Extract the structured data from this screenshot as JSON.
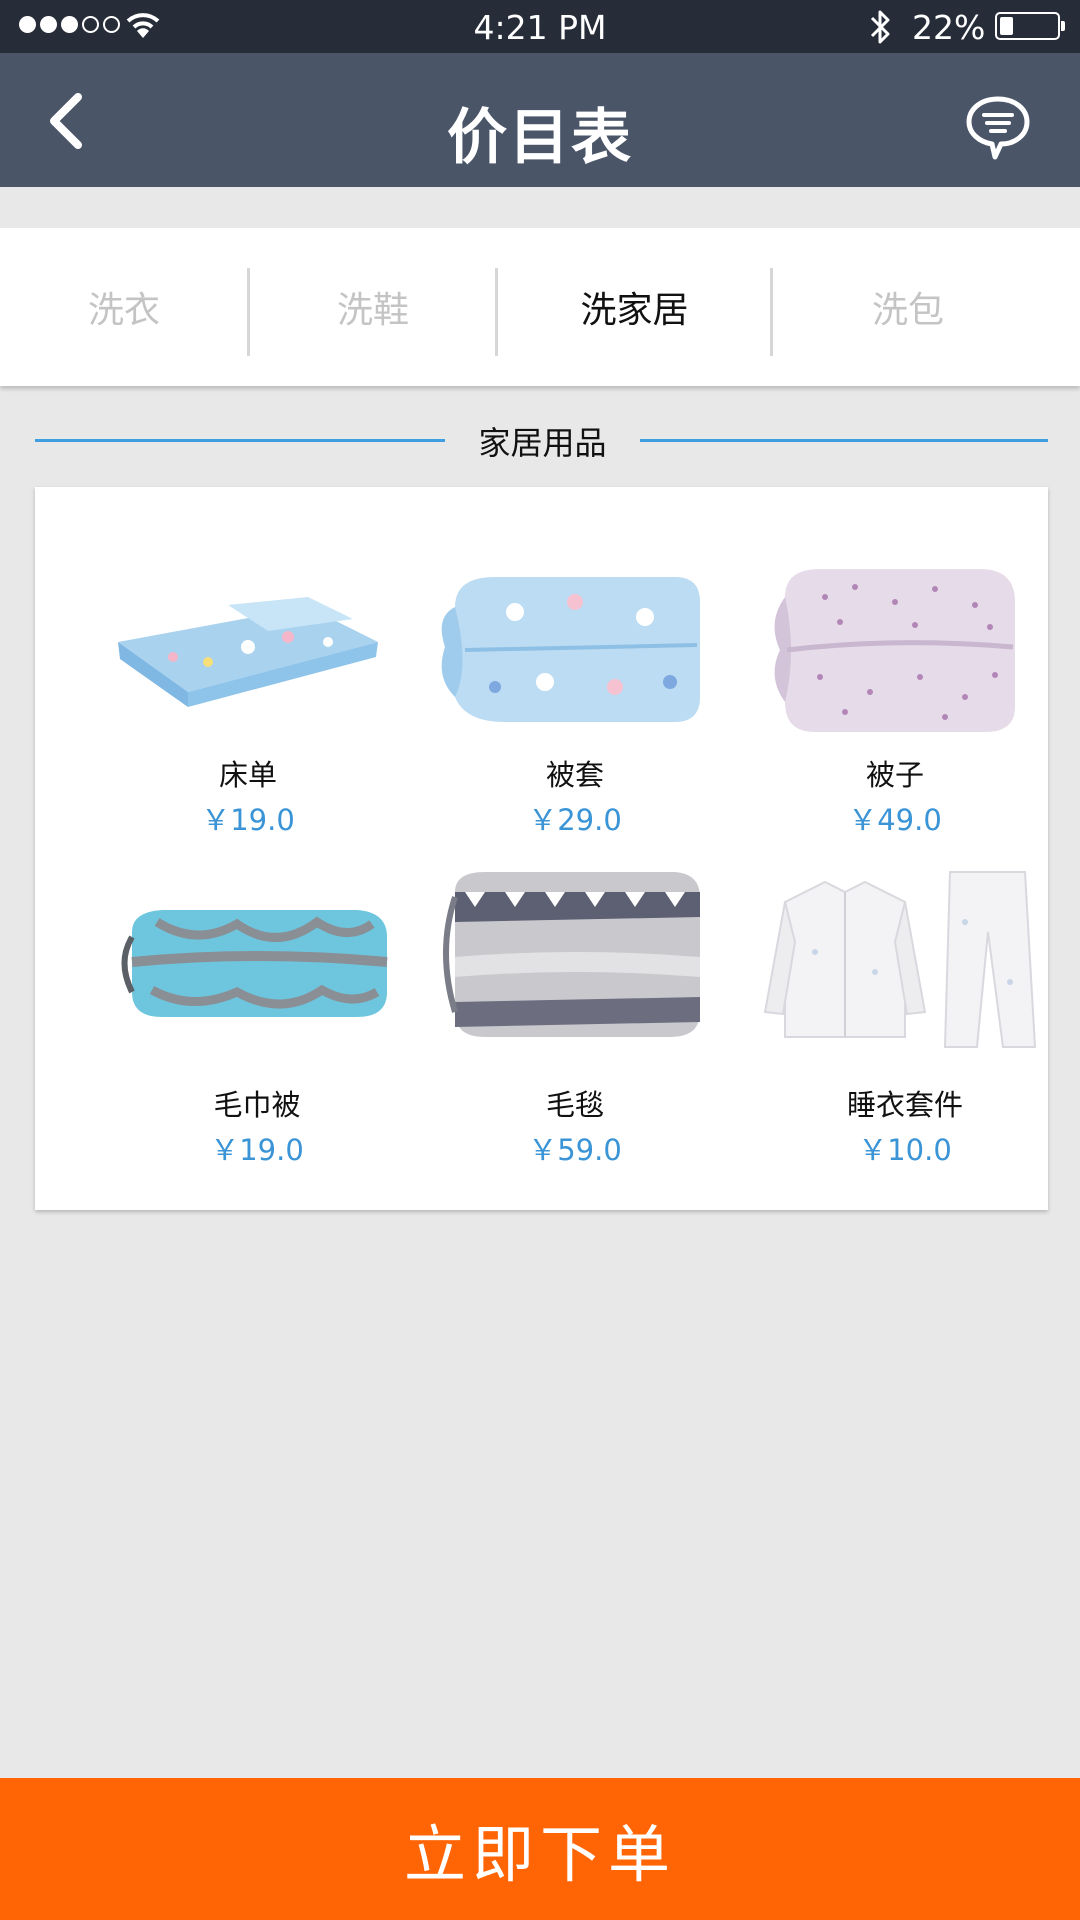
{
  "status_bar": {
    "time": "4:21 PM",
    "battery": "22%",
    "signal_bars": 3,
    "icons": [
      "signal-icon",
      "wifi-icon",
      "bluetooth-icon",
      "battery-icon"
    ]
  },
  "nav": {
    "title": "价目表",
    "back_icon": "chevron-left-icon",
    "message_icon": "chat-bubble-icon"
  },
  "tabs": [
    {
      "label": "洗衣",
      "active": false
    },
    {
      "label": "洗鞋",
      "active": false
    },
    {
      "label": "洗家居",
      "active": true
    },
    {
      "label": "洗包",
      "active": false
    }
  ],
  "section": {
    "title": "家居用品"
  },
  "products": [
    {
      "name": "床单",
      "price": "￥19.0",
      "image": "bed-sheet-image"
    },
    {
      "name": "被套",
      "price": "￥29.0",
      "image": "duvet-cover-image"
    },
    {
      "name": "被子",
      "price": "￥49.0",
      "image": "quilt-image"
    },
    {
      "name": "毛巾被",
      "price": "￥19.0",
      "image": "towel-blanket-image"
    },
    {
      "name": "毛毯",
      "price": "￥59.0",
      "image": "blanket-image"
    },
    {
      "name": "睡衣套件",
      "price": "￥10.0",
      "image": "pajamas-image"
    }
  ],
  "order_button": {
    "label": "立即下单"
  },
  "colors": {
    "status_bar": "#262c38",
    "nav_bar": "#4a5568",
    "accent_blue": "#3a94d6",
    "order_orange": "#ff6505",
    "background": "#e8e8e8"
  }
}
